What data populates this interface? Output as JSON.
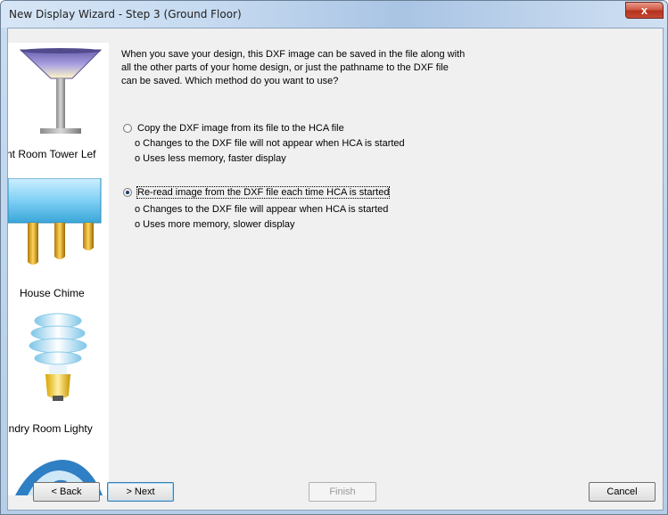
{
  "window": {
    "title": "New Display Wizard - Step 3 (Ground Floor)",
    "close_glyph": "x"
  },
  "sidebar": {
    "items": [
      {
        "label": "nt Room Tower Lef",
        "icon": "lamp-icon"
      },
      {
        "label": "House Chime",
        "icon": "chime-icon"
      },
      {
        "label": "indry Room Lighty",
        "icon": "cfl-bulb-icon"
      },
      {
        "label": "",
        "icon": "fan-icon"
      }
    ]
  },
  "main": {
    "intro_lines": [
      "When you save your design, this DXF image can be saved in the file along with",
      "all the other parts of your home design, or just the pathname to the DXF file",
      "can be saved.  Which method do you want to use?"
    ],
    "options": [
      {
        "label": "Copy the DXF image from its file to the HCA file",
        "checked": false,
        "notes": [
          "o  Changes to the DXF file will not appear when HCA is started",
          "o  Uses less memory, faster display"
        ]
      },
      {
        "label": "Re-read image from the DXF file each time HCA is started",
        "checked": true,
        "notes": [
          "o  Changes to the DXF file will appear when HCA is started",
          "o  Uses more memory, slower display"
        ]
      }
    ]
  },
  "buttons": {
    "back": "< Back",
    "next": "> Next",
    "finish": "Finish",
    "cancel": "Cancel"
  }
}
